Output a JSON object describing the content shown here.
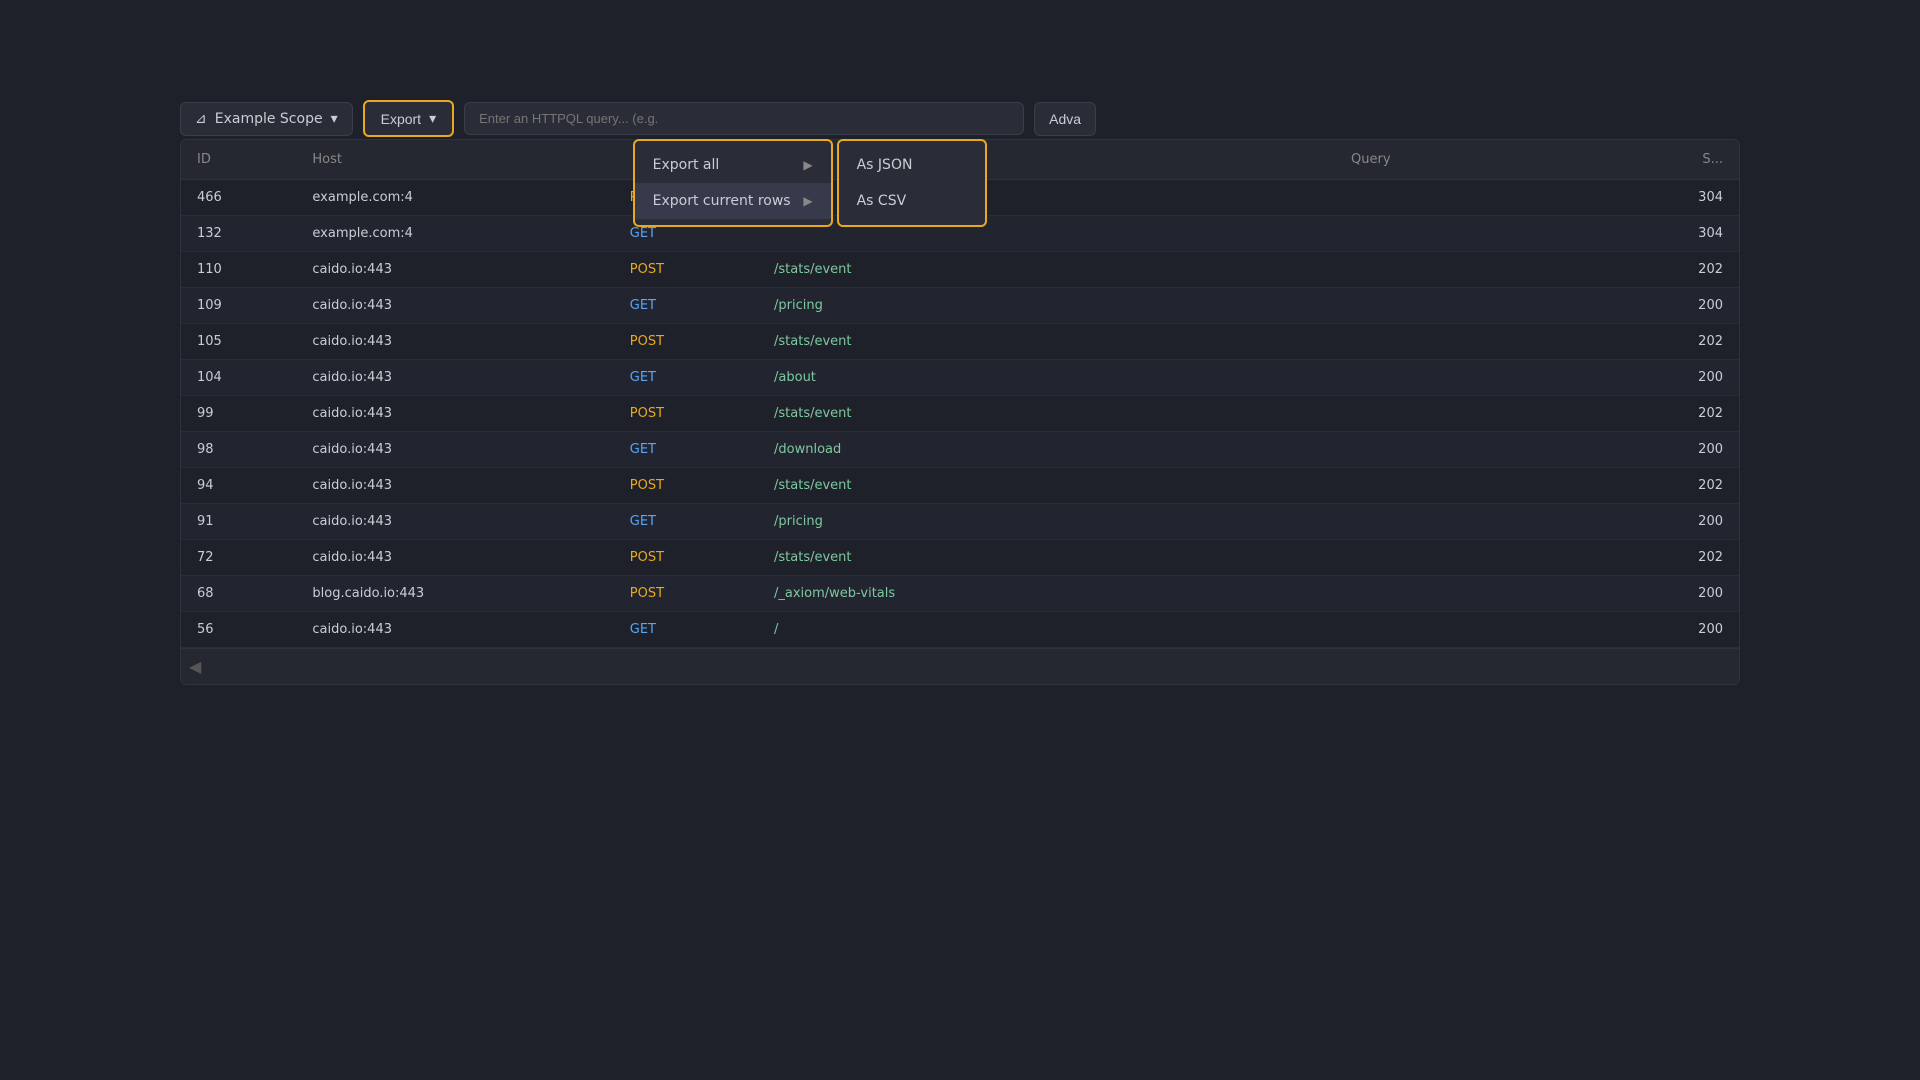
{
  "toolbar": {
    "scope_label": "Example Scope",
    "export_label": "Export",
    "search_placeholder": "Enter an HTTPQL query... (e.g.",
    "adv_label": "Adva"
  },
  "dropdown": {
    "export_all_label": "Export all",
    "export_current_rows_label": "Export current rows",
    "as_json_label": "As JSON",
    "as_csv_label": "As CSV"
  },
  "table": {
    "columns": [
      "ID",
      "Host",
      "",
      "Query",
      "S..."
    ],
    "rows": [
      {
        "id": "466",
        "host": "example.com:4",
        "method": "POST",
        "path": "",
        "query": "",
        "status": "304"
      },
      {
        "id": "132",
        "host": "example.com:4",
        "method": "GET",
        "path": "",
        "query": "",
        "status": "304"
      },
      {
        "id": "110",
        "host": "caido.io:443",
        "method": "POST",
        "path": "/stats/event",
        "query": "",
        "status": "202"
      },
      {
        "id": "109",
        "host": "caido.io:443",
        "method": "GET",
        "path": "/pricing",
        "query": "",
        "status": "200"
      },
      {
        "id": "105",
        "host": "caido.io:443",
        "method": "POST",
        "path": "/stats/event",
        "query": "",
        "status": "202"
      },
      {
        "id": "104",
        "host": "caido.io:443",
        "method": "GET",
        "path": "/about",
        "query": "",
        "status": "200"
      },
      {
        "id": "99",
        "host": "caido.io:443",
        "method": "POST",
        "path": "/stats/event",
        "query": "",
        "status": "202"
      },
      {
        "id": "98",
        "host": "caido.io:443",
        "method": "GET",
        "path": "/download",
        "query": "",
        "status": "200"
      },
      {
        "id": "94",
        "host": "caido.io:443",
        "method": "POST",
        "path": "/stats/event",
        "query": "",
        "status": "202"
      },
      {
        "id": "91",
        "host": "caido.io:443",
        "method": "GET",
        "path": "/pricing",
        "query": "",
        "status": "200"
      },
      {
        "id": "72",
        "host": "caido.io:443",
        "method": "POST",
        "path": "/stats/event",
        "query": "",
        "status": "202"
      },
      {
        "id": "68",
        "host": "blog.caido.io:443",
        "method": "POST",
        "path": "/_axiom/web-vitals",
        "query": "",
        "status": "200"
      },
      {
        "id": "56",
        "host": "caido.io:443",
        "method": "GET",
        "path": "/",
        "query": "",
        "status": "200"
      }
    ]
  },
  "icons": {
    "filter": "▼",
    "chevron_down": "▾",
    "chevron_right": "▶"
  },
  "colors": {
    "accent": "#e8a820",
    "background": "#1e2129",
    "surface": "#2a2d38",
    "border": "#3a3d4a",
    "text_primary": "#c9cdd4",
    "text_muted": "#888888",
    "method_post": "#e8a820",
    "method_get": "#5ba4f5",
    "path_color": "#7ec8a0"
  }
}
